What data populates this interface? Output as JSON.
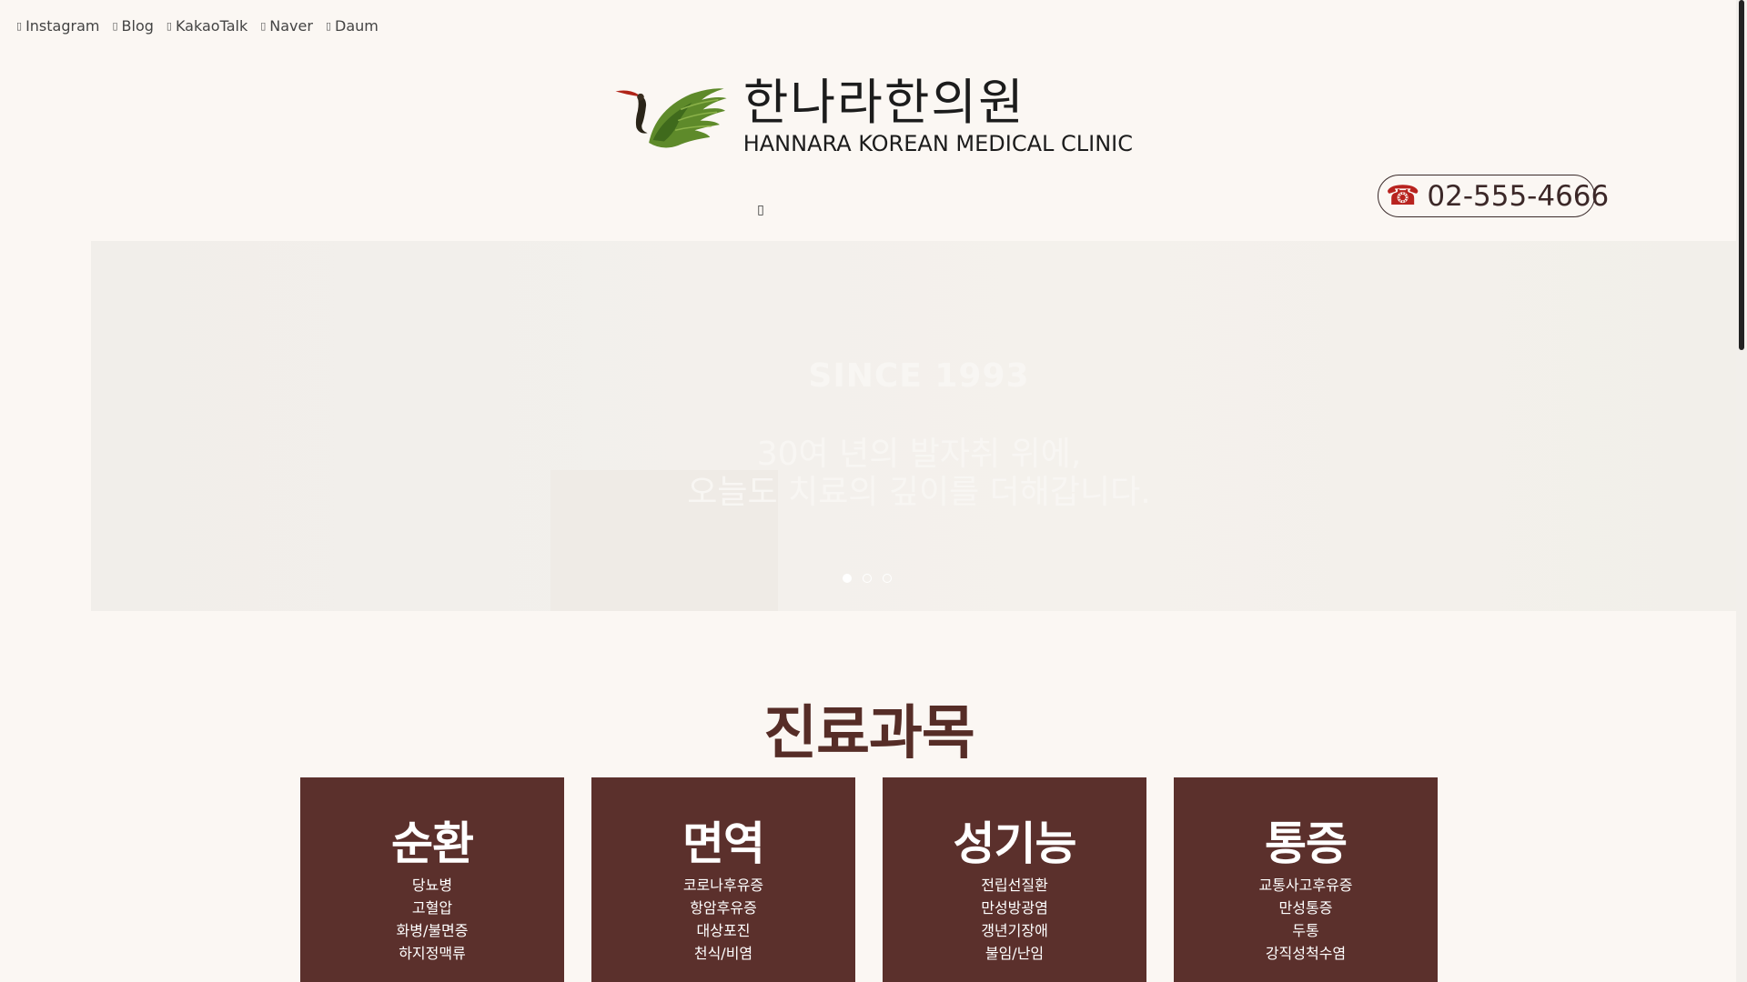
{
  "social": {
    "items": [
      {
        "label": "Instagram",
        "icon": "instagram-icon",
        "glyph": "▯"
      },
      {
        "label": "Blog",
        "icon": "blog-icon",
        "glyph": "▯"
      },
      {
        "label": "KakaoTalk",
        "icon": "kakaotalk-icon",
        "glyph": "▯"
      },
      {
        "label": "Naver",
        "icon": "naver-icon",
        "glyph": "▯"
      },
      {
        "label": "Daum",
        "icon": "daum-icon",
        "glyph": "▯"
      }
    ]
  },
  "logo": {
    "korean": "한나라한의원",
    "english": "HANNARA KOREAN MEDICAL CLINIC"
  },
  "nav": {
    "toggle_glyph": "▯"
  },
  "phone": {
    "number": "02-555-4666",
    "icon_glyph": "☎"
  },
  "hero": {
    "since": "SINCE 1993",
    "line1": "30여 년의 발자취 위에,",
    "line2": "오늘도 치료의 깊이를 더해갑니다.",
    "slide_count": 3,
    "active_slide": 1
  },
  "departments": {
    "title": "진료과목",
    "cards": [
      {
        "title": "순환",
        "items": [
          "당뇨병",
          "고혈압",
          "화병/불면증",
          "하지정맥류"
        ]
      },
      {
        "title": "면역",
        "items": [
          "코로나후유증",
          "항암후유증",
          "대상포진",
          "천식/비염"
        ]
      },
      {
        "title": "성기능",
        "items": [
          "전립선질환",
          "만성방광염",
          "갱년기장애",
          "불임/난임"
        ]
      },
      {
        "title": "통증",
        "items": [
          "교통사고후유증",
          "만성통증",
          "두통",
          "강직성척수염"
        ]
      }
    ]
  },
  "colors": {
    "brand": "#5b302c",
    "title": "#562d27",
    "background": "#fbf7f3",
    "phone_icon": "#b8231f"
  }
}
